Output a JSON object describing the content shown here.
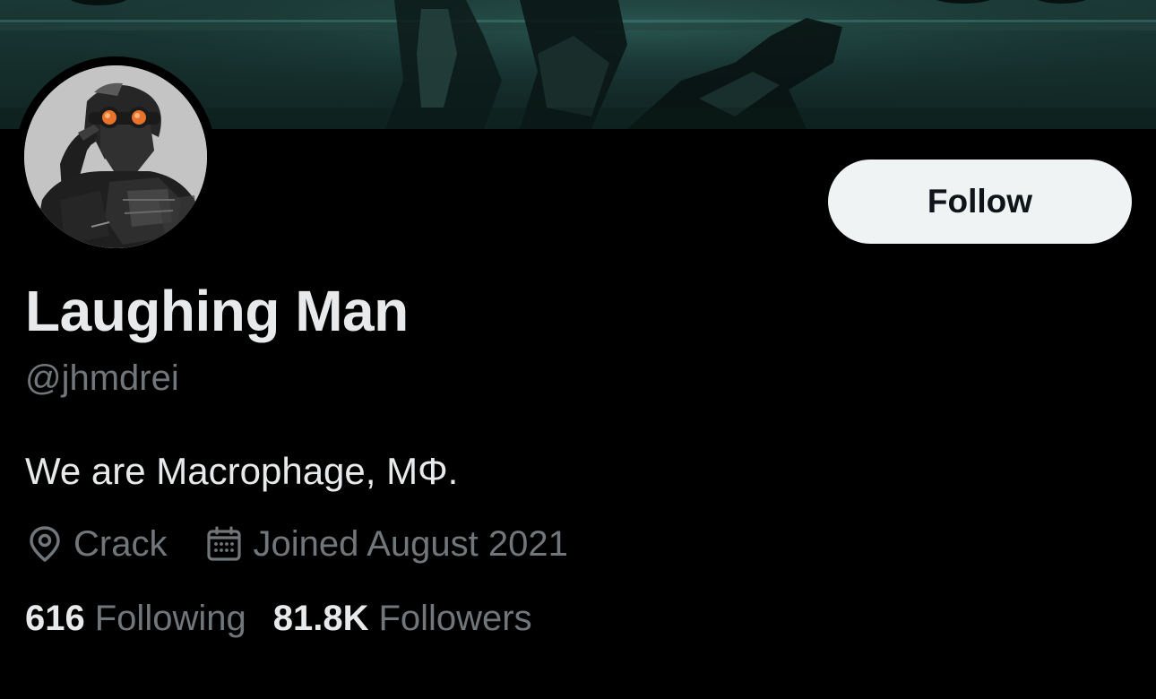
{
  "profile": {
    "display_name": "Laughing Man",
    "handle": "@jhmdrei",
    "bio": "We are Macrophage, MΦ.",
    "location": "Crack",
    "joined": "Joined August 2021",
    "following_count": "616",
    "following_label": "Following",
    "followers_count": "81.8K",
    "followers_label": "Followers"
  },
  "actions": {
    "follow_label": "Follow"
  },
  "icons": {
    "location": "location-pin-icon",
    "joined": "calendar-icon"
  },
  "colors": {
    "background": "#000000",
    "text_primary": "#e7e9ea",
    "text_secondary": "#71767b",
    "follow_button_bg": "#eff3f4",
    "follow_button_text": "#0f1419",
    "avatar_eye_accent": "#e8732a"
  }
}
